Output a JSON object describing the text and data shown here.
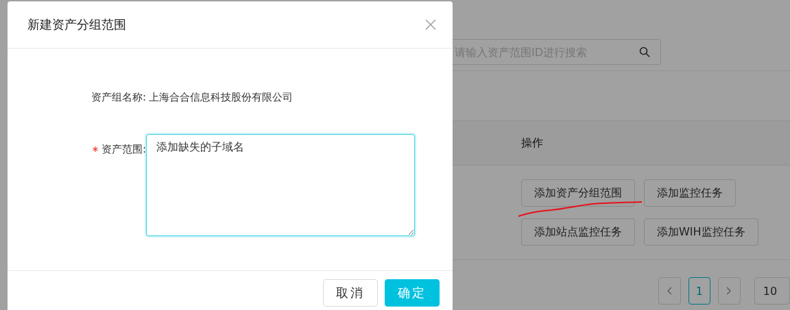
{
  "page": {
    "search": {
      "placeholder": "请输入资产范围ID进行搜索"
    },
    "table": {
      "columns": [
        {
          "label": "操作"
        }
      ],
      "rows": [
        {
          "actions": [
            {
              "label": "添加资产分组范围"
            },
            {
              "label": "添加监控任务"
            },
            {
              "label": "添加站点监控任务"
            },
            {
              "label": "添加WIH监控任务"
            }
          ]
        }
      ]
    },
    "pagination": {
      "pages": [
        {
          "label": "1",
          "selected": true
        }
      ],
      "page_size": "10"
    }
  },
  "dialog": {
    "title": "新建资产分组范围",
    "fields": [
      {
        "kind": "text",
        "label": "资产组名称:",
        "value": "上海合合信息科技股份有限公司",
        "required": false
      },
      {
        "kind": "textarea",
        "label": "资产范围:",
        "value": "添加缺失的子域名",
        "required": true,
        "focused": true
      }
    ],
    "buttons": [
      {
        "label": "取消",
        "kind": "default"
      },
      {
        "label": "确定",
        "kind": "primary"
      }
    ]
  }
}
